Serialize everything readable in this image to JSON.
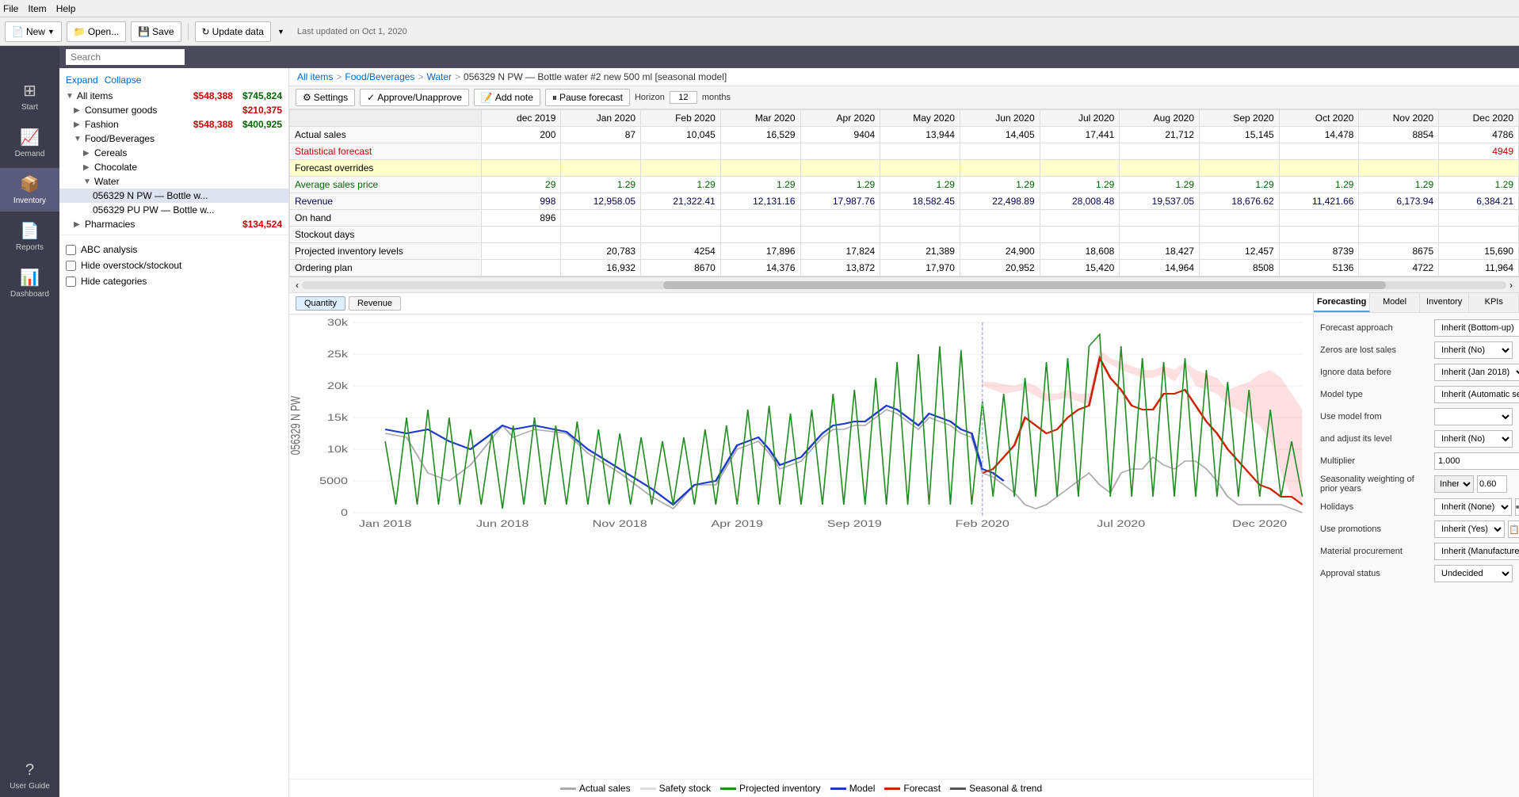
{
  "menubar": {
    "items": [
      "File",
      "Item",
      "Help"
    ]
  },
  "toolbar": {
    "new_label": "New",
    "open_label": "Open...",
    "save_label": "Save",
    "update_label": "Update data",
    "last_updated": "Last updated on Oct 1, 2020"
  },
  "search": {
    "placeholder": "Search"
  },
  "sidebar": {
    "items": [
      {
        "id": "start",
        "label": "Start",
        "icon": "⊞"
      },
      {
        "id": "demand",
        "label": "Demand",
        "icon": "📈"
      },
      {
        "id": "inventory",
        "label": "Inventory",
        "icon": "📦"
      },
      {
        "id": "reports",
        "label": "Reports",
        "icon": "📄"
      },
      {
        "id": "dashboard",
        "label": "Dashboard",
        "icon": "📊"
      }
    ],
    "active": "inventory"
  },
  "left_panel": {
    "expand_label": "Expand",
    "collapse_label": "Collapse",
    "tree": [
      {
        "id": "all",
        "label": "All items",
        "val1": "$548,388",
        "val2": "$745,824",
        "level": 0,
        "expanded": true,
        "arrow": "▼"
      },
      {
        "id": "consumer",
        "label": "Consumer goods",
        "val1": "$210,375",
        "val2": "",
        "level": 1,
        "expanded": false,
        "arrow": "▶"
      },
      {
        "id": "fashion",
        "label": "Fashion",
        "val1": "$548,388",
        "val2": "$400,925",
        "level": 1,
        "expanded": false,
        "arrow": "▶"
      },
      {
        "id": "food",
        "label": "Food/Beverages",
        "val1": "",
        "val2": "",
        "level": 1,
        "expanded": true,
        "arrow": "▼"
      },
      {
        "id": "cereals",
        "label": "Cereals",
        "val1": "",
        "val2": "",
        "level": 2,
        "expanded": false,
        "arrow": "▶"
      },
      {
        "id": "chocolate",
        "label": "Chocolate",
        "val1": "",
        "val2": "",
        "level": 2,
        "expanded": false,
        "arrow": "▶"
      },
      {
        "id": "water",
        "label": "Water",
        "val1": "",
        "val2": "",
        "level": 2,
        "expanded": true,
        "arrow": "▼"
      },
      {
        "id": "water1",
        "label": "056329 N PW — Bottle w...",
        "val1": "",
        "val2": "",
        "level": 3,
        "expanded": false,
        "arrow": "",
        "selected": true
      },
      {
        "id": "water2",
        "label": "056329 PU PW — Bottle w...",
        "val1": "",
        "val2": "",
        "level": 3,
        "expanded": false,
        "arrow": ""
      },
      {
        "id": "pharmacies",
        "label": "Pharmacies",
        "val1": "$134,524",
        "val2": "",
        "level": 1,
        "expanded": false,
        "arrow": "▶"
      }
    ],
    "checkboxes": [
      {
        "id": "abc",
        "label": "ABC analysis",
        "checked": false
      },
      {
        "id": "overstock",
        "label": "Hide overstock/stockout",
        "checked": false
      },
      {
        "id": "categories",
        "label": "Hide categories",
        "checked": false
      }
    ]
  },
  "breadcrumb": {
    "parts": [
      "All items",
      "Food/Beverages",
      "Water",
      "056329 N PW — Bottle water #2 new 500 ml [seasonal model]"
    ],
    "separators": [
      ">",
      ">",
      ">"
    ]
  },
  "action_bar": {
    "settings_label": "Settings",
    "approve_label": "Approve/Unapprove",
    "add_note_label": "Add note",
    "pause_forecast_label": "Pause forecast",
    "horizon_label": "Horizon",
    "horizon_value": "12",
    "months_label": "months"
  },
  "table": {
    "columns": [
      "dec 2019",
      "Jan 2020",
      "Feb 2020",
      "Mar 2020",
      "Apr 2020",
      "May 2020",
      "Jun 2020",
      "Jul 2020",
      "Aug 2020",
      "Sep 2020",
      "Oct 2020",
      "Nov 2020",
      "Dec 2020"
    ],
    "rows": [
      {
        "label": "Actual sales",
        "type": "normal",
        "values": [
          "200",
          "87",
          "10,045",
          "16,529",
          "9404",
          "13,944",
          "14,405",
          "17,441",
          "21,712",
          "15,145",
          "14,478",
          "8854",
          "4786"
        ]
      },
      {
        "label": "Statistical forecast",
        "type": "forecast",
        "values": [
          "",
          "",
          "",
          "",
          "",
          "",
          "",
          "",
          "",
          "",
          "",
          "",
          "4949"
        ]
      },
      {
        "label": "Forecast overrides",
        "type": "override",
        "values": [
          "",
          "",
          "",
          "",
          "",
          "",
          "",
          "",
          "",
          "",
          "",
          "",
          ""
        ]
      },
      {
        "label": "Average sales price",
        "type": "price",
        "values": [
          "29",
          "1.29",
          "1.29",
          "1.29",
          "1.29",
          "1.29",
          "1.29",
          "1.29",
          "1.29",
          "1.29",
          "1.29",
          "1.29",
          "1.29"
        ]
      },
      {
        "label": "Revenue",
        "type": "revenue",
        "values": [
          "998",
          "12,958.05",
          "21,322.41",
          "12,131.16",
          "17,987.76",
          "18,582.45",
          "22,498.89",
          "28,008.48",
          "19,537.05",
          "18,676.62",
          "11,421.66",
          "6,173.94",
          "6,384.21"
        ]
      },
      {
        "label": "On hand",
        "type": "normal",
        "values": [
          "896",
          "",
          "",
          "",
          "",
          "",
          "",
          "",
          "",
          "",
          "",
          "",
          ""
        ]
      },
      {
        "label": "Stockout days",
        "type": "normal",
        "values": [
          "",
          "",
          "",
          "",
          "",
          "",
          "",
          "",
          "",
          "",
          "",
          "",
          ""
        ]
      },
      {
        "label": "Projected inventory levels",
        "type": "normal",
        "values": [
          "",
          "20,783",
          "4254",
          "17,896",
          "17,824",
          "21,389",
          "24,900",
          "18,608",
          "18,427",
          "12,457",
          "8739",
          "8675",
          "15,690"
        ]
      },
      {
        "label": "Ordering plan",
        "type": "normal",
        "values": [
          "",
          "16,932",
          "8670",
          "14,376",
          "13,872",
          "17,970",
          "20,952",
          "15,420",
          "14,964",
          "8508",
          "5136",
          "4722",
          "11,964"
        ]
      }
    ]
  },
  "chart": {
    "tabs": [
      "Quantity",
      "Revenue"
    ],
    "active_tab": "Quantity",
    "y_label": "056329 N PW",
    "y_ticks": [
      "0",
      "5000",
      "10k",
      "15k",
      "20k",
      "25k",
      "30k"
    ],
    "x_ticks": [
      "Jan 2018",
      "Jun 2018",
      "Nov 2018",
      "Apr 2019",
      "Sep 2019",
      "Feb 2020",
      "Jul 2020",
      "Dec 2020"
    ],
    "legend": [
      {
        "label": "Actual sales",
        "color": "#aaaaaa",
        "type": "line"
      },
      {
        "label": "Safety stock",
        "color": "#dddddd",
        "type": "line"
      },
      {
        "label": "Projected inventory",
        "color": "#228B22",
        "type": "line"
      },
      {
        "label": "Model",
        "color": "#1a3acc",
        "type": "line"
      },
      {
        "label": "Forecast",
        "color": "#cc2200",
        "type": "line"
      },
      {
        "label": "Seasonal & trend",
        "color": "#555555",
        "type": "line"
      }
    ]
  },
  "forecast_panel": {
    "tabs": [
      "Forecasting",
      "Model",
      "Inventory",
      "KPIs"
    ],
    "active_tab": "Forecasting",
    "fields": [
      {
        "label": "Forecast approach",
        "value": "Inherit (Bottom-up)"
      },
      {
        "label": "Zeros are lost sales",
        "value": "Inherit (No)"
      },
      {
        "label": "Ignore data before",
        "value": "Inherit (Jan 2018)"
      },
      {
        "label": "Model type",
        "value": "Inherit (Automatic selection)"
      },
      {
        "label": "Use model from",
        "value": ""
      },
      {
        "label": "and adjust its level",
        "value": "Inherit (No)"
      },
      {
        "label": "Multiplier",
        "value": "1.000"
      },
      {
        "label": "Seasonality weighting of prior years",
        "value": "Inherit",
        "extra": "0.60"
      },
      {
        "label": "Holidays",
        "value": "Inherit (None)"
      },
      {
        "label": "Use promotions",
        "value": "Inherit (Yes)"
      },
      {
        "label": "Material procurement",
        "value": "Inherit (Manufacture)"
      },
      {
        "label": "Approval status",
        "value": "Undecided"
      }
    ]
  }
}
